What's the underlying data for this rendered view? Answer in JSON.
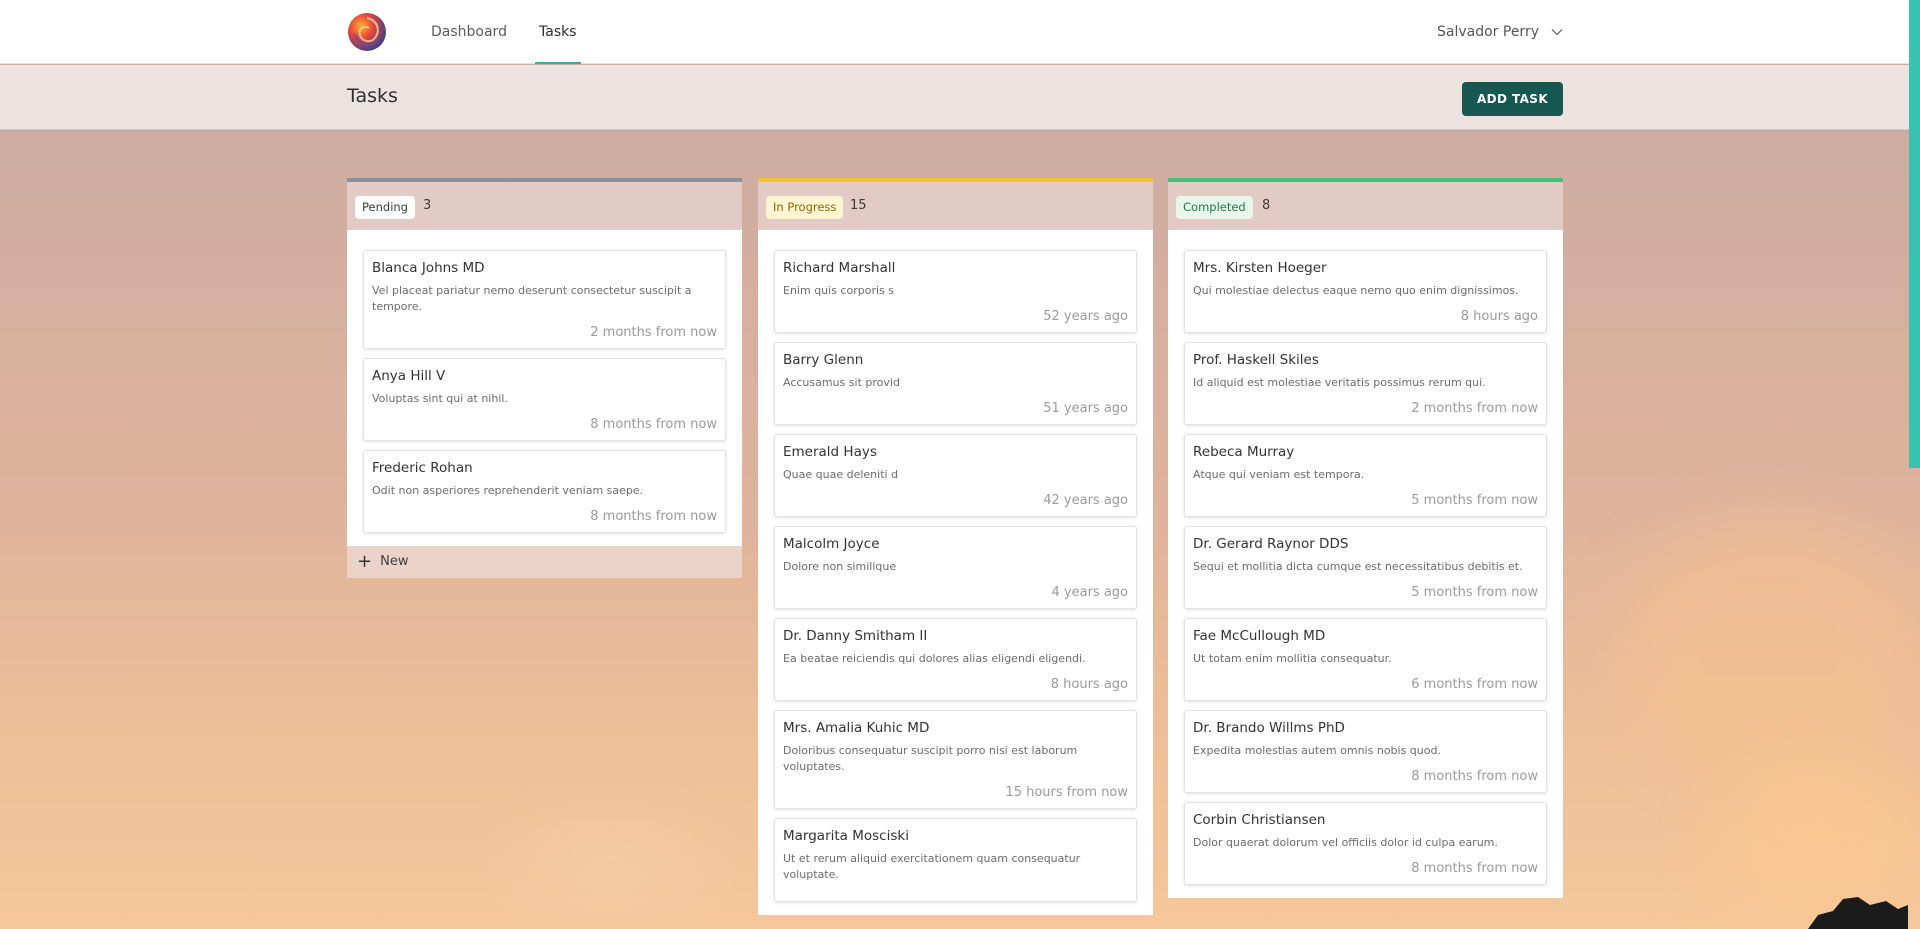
{
  "nav": {
    "links": [
      "Dashboard",
      "Tasks"
    ],
    "active": "Tasks",
    "user_name": "Salvador Perry"
  },
  "header": {
    "title": "Tasks",
    "add_button": "ADD TASK"
  },
  "columns": [
    {
      "status": "Pending",
      "count": "3",
      "cards": [
        {
          "title": "Blanca Johns MD",
          "desc": "Vel placeat pariatur nemo deserunt consectetur suscipit a tempore.",
          "time": "2 months from now"
        },
        {
          "title": "Anya Hill V",
          "desc": "Voluptas sint qui at nihil.",
          "time": "8 months from now"
        },
        {
          "title": "Frederic Rohan",
          "desc": "Odit non asperiores reprehenderit veniam saepe.",
          "time": "8 months from now"
        }
      ],
      "new_label": "New"
    },
    {
      "status": "In Progress",
      "count": "15",
      "cards": [
        {
          "title": "Richard Marshall",
          "desc": "Enim quis corporis s",
          "time": "52 years ago"
        },
        {
          "title": "Barry Glenn",
          "desc": "Accusamus sit provid",
          "time": "51 years ago"
        },
        {
          "title": "Emerald Hays",
          "desc": "Quae quae deleniti d",
          "time": "42 years ago"
        },
        {
          "title": "Malcolm Joyce",
          "desc": "Dolore non similique",
          "time": "4 years ago"
        },
        {
          "title": "Dr. Danny Smitham II",
          "desc": "Ea beatae reiciendis qui dolores alias eligendi eligendi.",
          "time": "8 hours ago"
        },
        {
          "title": "Mrs. Amalia Kuhic MD",
          "desc": "Doloribus consequatur suscipit porro nisi est laborum voluptates.",
          "time": "15 hours from now"
        },
        {
          "title": "Margarita Mosciski",
          "desc": "Ut et rerum aliquid exercitationem quam consequatur voluptate.",
          "time": ""
        }
      ]
    },
    {
      "status": "Completed",
      "count": "8",
      "cards": [
        {
          "title": "Mrs. Kirsten Hoeger",
          "desc": "Qui molestiae delectus eaque nemo quo enim dignissimos.",
          "time": "8 hours ago"
        },
        {
          "title": "Prof. Haskell Skiles",
          "desc": "Id aliquid est molestiae veritatis possimus rerum qui.",
          "time": "2 months from now"
        },
        {
          "title": "Rebeca Murray",
          "desc": "Atque qui veniam est tempora.",
          "time": "5 months from now"
        },
        {
          "title": "Dr. Gerard Raynor DDS",
          "desc": "Sequi et mollitia dicta cumque est necessitatibus debitis et.",
          "time": "5 months from now"
        },
        {
          "title": "Fae McCullough MD",
          "desc": "Ut totam enim mollitia consequatur.",
          "time": "6 months from now"
        },
        {
          "title": "Dr. Brando Willms PhD",
          "desc": "Expedita molestias autem omnis nobis quod.",
          "time": "8 months from now"
        },
        {
          "title": "Corbin Christiansen",
          "desc": "Dolor quaerat dolorum vel officiis dolor id culpa earum.",
          "time": "8 months from now"
        }
      ]
    }
  ],
  "colors": {
    "accent": "#2bb3a1",
    "button": "#16574f",
    "pending": "#8d8f9a",
    "in_progress": "#f2c233",
    "completed": "#45c07a"
  },
  "icons": [
    "logo-icon",
    "chevron-down-icon",
    "plus-icon"
  ]
}
